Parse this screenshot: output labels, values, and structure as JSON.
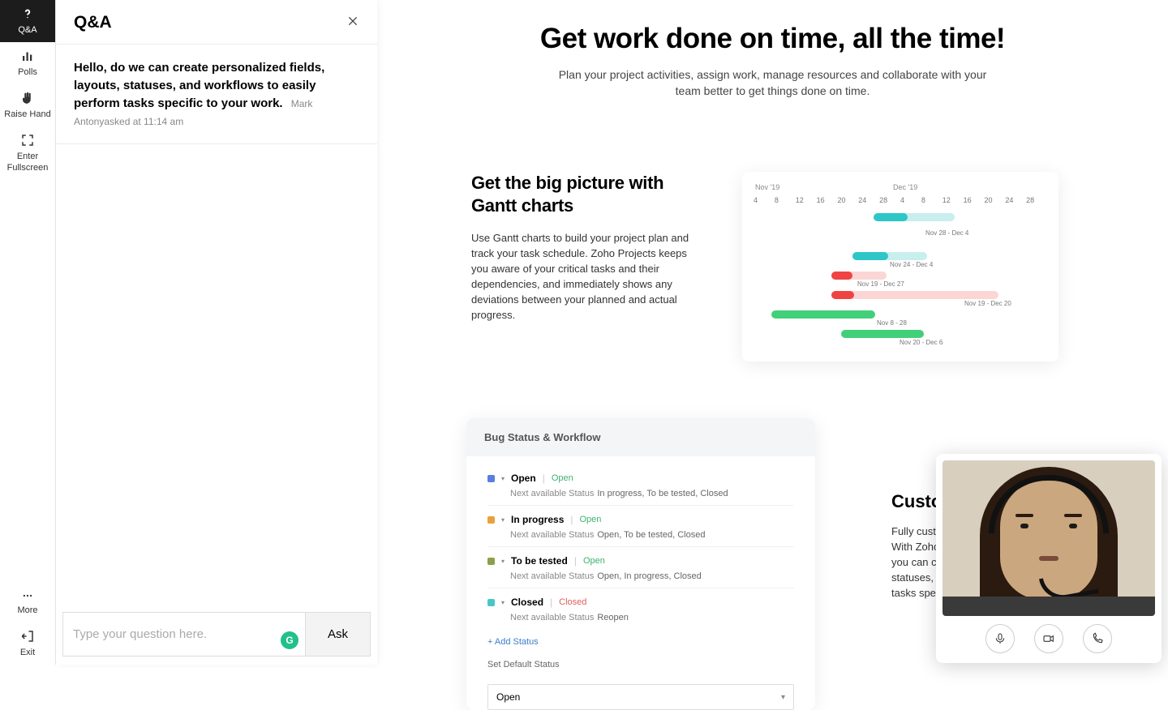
{
  "rail": {
    "qa": "Q&A",
    "polls": "Polls",
    "raise": "Raise Hand",
    "fullscreen": "Enter Fullscreen",
    "more": "More",
    "exit": "Exit"
  },
  "qa_panel": {
    "title": "Q&A",
    "question_text": "Hello, do we can create personalized fields, layouts, statuses, and workflows to easily perform tasks specific to your work.",
    "question_meta": "Mark Antonyasked at 11:14 am",
    "placeholder": "Type your question here.",
    "ask": "Ask"
  },
  "hero": {
    "title": "Get work done on time, all the time!",
    "sub": "Plan your project activities, assign work, manage resources and collaborate with your team better to get things done on time."
  },
  "gantt": {
    "title": "Get the big picture with Gantt charts",
    "body": "Use Gantt charts to build your project plan and track your task schedule. Zoho Projects keeps you aware of your critical tasks and their dependencies, and immediately shows any deviations between your planned and actual progress.",
    "month1": "Nov '19",
    "month2": "Dec '19",
    "days": [
      "4",
      "8",
      "12",
      "16",
      "20",
      "24",
      "28",
      "4",
      "8",
      "12",
      "16",
      "20",
      "24",
      "28"
    ],
    "cap1": "Nov 28 - Dec 4",
    "cap2": "Nov 24 - Dec 4",
    "cap3": "Nov 19 - Dec 27",
    "cap4": "Nov 19 - Dec 20",
    "cap5": "Nov 8 - 28",
    "cap6": "Nov 20 - Dec 6"
  },
  "wf": {
    "hdr": "Bug Status & Workflow",
    "items": [
      {
        "color": "#5a7ee0",
        "name": "Open",
        "tag": "Open",
        "tagClass": "open",
        "next_lbl": "Next available Status",
        "next": "In progress, To be tested, Closed"
      },
      {
        "color": "#e7a23c",
        "name": "In progress",
        "tag": "Open",
        "tagClass": "open",
        "next_lbl": "Next available Status",
        "next": "Open, To be tested, Closed"
      },
      {
        "color": "#8aa04a",
        "name": "To be tested",
        "tag": "Open",
        "tagClass": "open",
        "next_lbl": "Next available Status",
        "next": "Open, In progress, Closed"
      },
      {
        "color": "#49c6c6",
        "name": "Closed",
        "tag": "Closed",
        "tagClass": "closed",
        "next_lbl": "Next available Status",
        "next": "Reopen"
      }
    ],
    "add": "+ Add Status",
    "default_lbl": "Set Default Status",
    "default_val": "Open",
    "text_title": "Custo",
    "text_body": "Fully custo\nWith Zoho P\nyou can cre\nstatuses, an\ntasks specif"
  }
}
